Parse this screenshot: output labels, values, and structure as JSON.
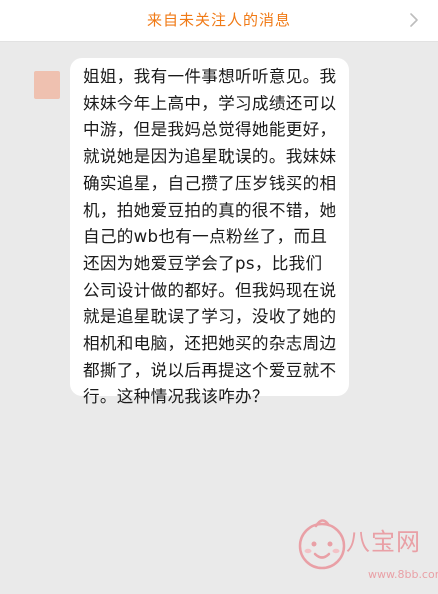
{
  "header": {
    "title": "来自未关注人的消息",
    "chevron_icon": "chevron-right-icon",
    "title_color": "#f07a16"
  },
  "conversation": {
    "avatar_color": "#efc1b0",
    "message_text": "姐姐，我有一件事想听听意见。我妹妹今年上高中，学习成绩还可以中游，但是我妈总觉得她能更好，就说她是因为追星耽误的。我妹妹确实追星，自己攒了压岁钱买的相机，拍她爱豆拍的真的很不错，她自己的wb也有一点粉丝了，而且还因为她爱豆学会了ps，比我们公司设计做的都好。但我妈现在说就是追星耽误了学习，没收了她的相机和电脑，还把她买的杂志周边都撕了，说以后再提这个爱豆就不行。这种情况我该咋办？"
  },
  "watermark": {
    "logo_icon": "baby-face-logo-icon",
    "name": "八宝网",
    "url": "www.8bb.com"
  }
}
